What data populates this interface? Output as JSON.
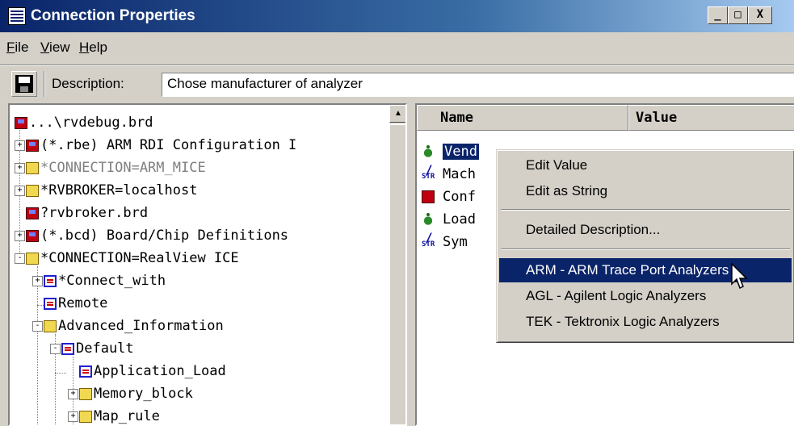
{
  "window": {
    "title": "Connection Properties",
    "controls": {
      "minimize": "_",
      "maximize": "□",
      "close": "X"
    }
  },
  "menubar": {
    "items": [
      {
        "label_rest": "ile",
        "accel": "F"
      },
      {
        "label_rest": "iew",
        "accel": "V"
      },
      {
        "label_rest": "elp",
        "accel": "H"
      }
    ]
  },
  "toolbar": {
    "save_icon": "floppy-disk-icon",
    "description_label": "Description:",
    "description_value": "Chose manufacturer of analyzer"
  },
  "tree": {
    "items": [
      {
        "label": "...\\rvdebug.brd",
        "icon": "disk"
      },
      {
        "label": "(*.rbe) ARM RDI Configuration I",
        "icon": "disk",
        "expander": "+"
      },
      {
        "label": "*CONNECTION=ARM_MICE",
        "icon": "folder",
        "expander": "+",
        "disabled": true
      },
      {
        "label": "*RVBROKER=localhost",
        "icon": "folder",
        "expander": "+"
      },
      {
        "label": "?rvbroker.brd",
        "icon": "disk"
      },
      {
        "label": "(*.bcd) Board/Chip Definitions",
        "icon": "disk",
        "expander": "+"
      },
      {
        "label": "*CONNECTION=RealView ICE",
        "icon": "folder",
        "expander": "-"
      },
      {
        "label": "*Connect_with",
        "icon": "doc",
        "expander": "+"
      },
      {
        "label": "Remote",
        "icon": "doc"
      },
      {
        "label": "Advanced_Information",
        "icon": "folder",
        "expander": "-"
      },
      {
        "label": "Default",
        "icon": "doc",
        "expander": "-"
      },
      {
        "label": "Application_Load",
        "icon": "doc"
      },
      {
        "label": "Memory_block",
        "icon": "folder",
        "expander": "+"
      },
      {
        "label": "Map_rule",
        "icon": "folder",
        "expander": "+"
      }
    ]
  },
  "properties": {
    "columns": [
      "Name",
      "Value"
    ],
    "rows": [
      {
        "name": "Vend",
        "icon": "bug-icon",
        "selected": true
      },
      {
        "name": "Mach",
        "icon": "string-icon"
      },
      {
        "name": "Conf",
        "icon": "disk-icon"
      },
      {
        "name": "Load",
        "icon": "bug-icon"
      },
      {
        "name": "Sym",
        "icon": "string-icon"
      }
    ]
  },
  "context_menu": {
    "edit_value": "Edit Value",
    "edit_as_string": "Edit as String",
    "detailed_description": "Detailed Description...",
    "options": [
      {
        "label": "ARM - ARM Trace Port Analyzers",
        "highlighted": true
      },
      {
        "label": "AGL - Agilent Logic Analyzers"
      },
      {
        "label": "TEK - Tektronix Logic Analyzers"
      }
    ]
  }
}
